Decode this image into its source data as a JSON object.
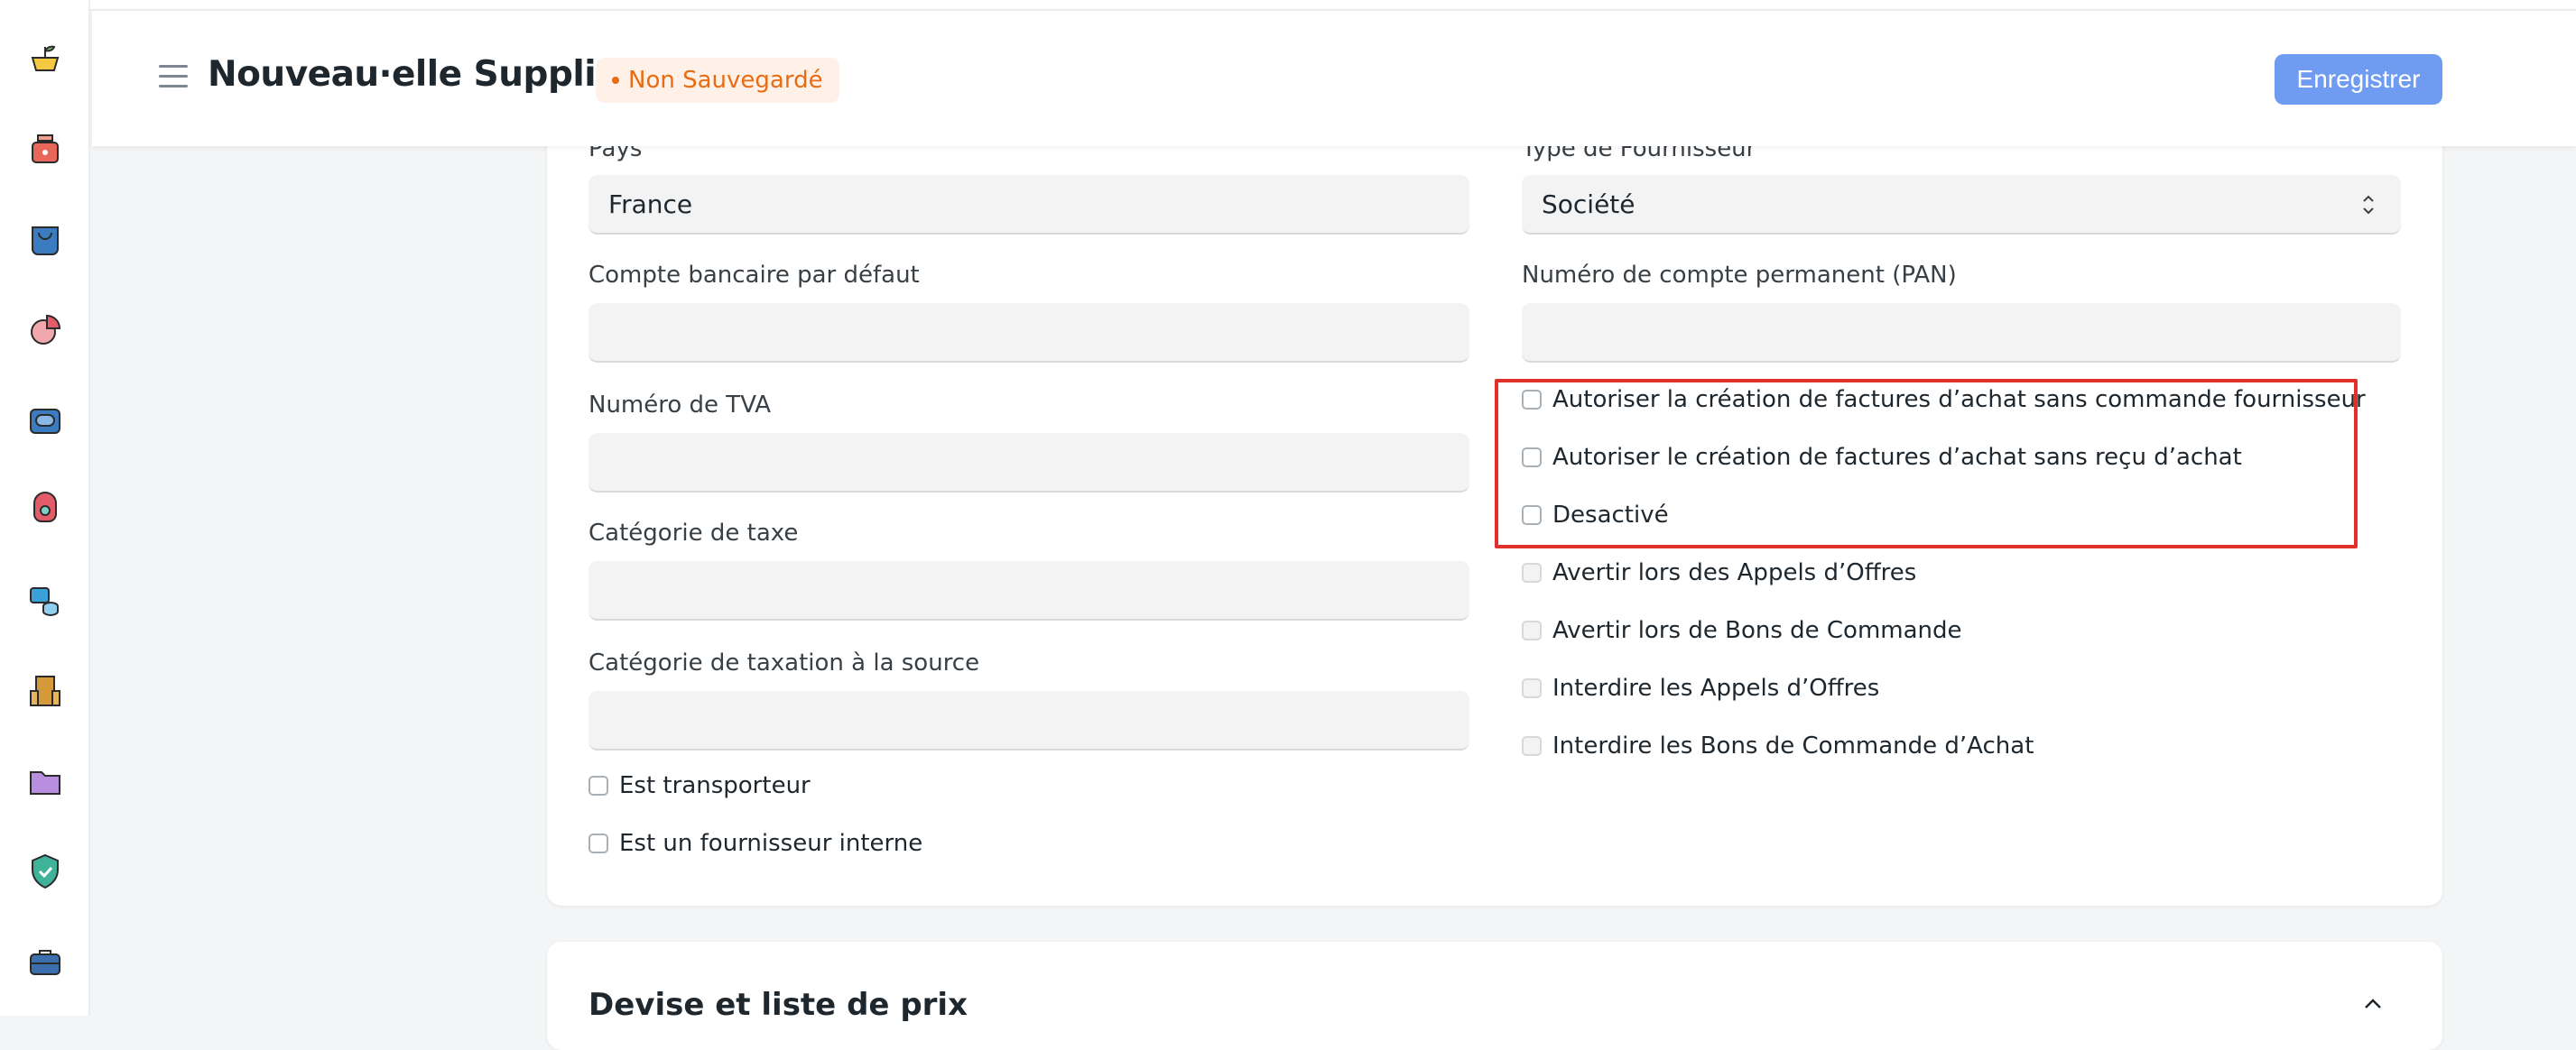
{
  "header": {
    "title": "Nouveau·elle Supplier",
    "status_badge": "Non Sauvegardé",
    "save_label": "Enregistrer"
  },
  "sidebar": {
    "icons": [
      "cart-icon",
      "pos-icon",
      "shopping-bag-icon",
      "pie-chart-icon",
      "stock-icon",
      "support-icon",
      "assets-icon",
      "buildings-icon",
      "folder-icon",
      "shield-check-icon",
      "briefcase-icon"
    ]
  },
  "form": {
    "country": {
      "label": "Pays",
      "value": "France"
    },
    "supplier_type": {
      "label": "Type de Fournisseur",
      "value": "Société"
    },
    "default_bank_account": {
      "label": "Compte bancaire par défaut",
      "value": ""
    },
    "pan": {
      "label": "Numéro de compte permanent (PAN)",
      "value": ""
    },
    "vat_number": {
      "label": "Numéro de TVA",
      "value": ""
    },
    "tax_category": {
      "label": "Catégorie de taxe",
      "value": ""
    },
    "withholding_tax_category": {
      "label": "Catégorie de taxation à la source",
      "value": ""
    },
    "left_checks": [
      {
        "label": "Est transporteur",
        "checked": false
      },
      {
        "label": "Est un fournisseur interne",
        "checked": false
      }
    ],
    "right_checks": [
      {
        "label": "Autoriser la création de factures d’achat sans commande fournisseur",
        "checked": false,
        "disabled": false
      },
      {
        "label": "Autoriser le création de factures d’achat sans reçu d’achat",
        "checked": false,
        "disabled": false
      },
      {
        "label": "Desactivé",
        "checked": false,
        "disabled": false
      },
      {
        "label": "Avertir lors des Appels d’Offres",
        "checked": false,
        "disabled": true
      },
      {
        "label": "Avertir lors de Bons de Commande",
        "checked": false,
        "disabled": true
      },
      {
        "label": "Interdire les Appels d’Offres",
        "checked": false,
        "disabled": true
      },
      {
        "label": "Interdire les Bons de Commande d’Achat",
        "checked": false,
        "disabled": true
      }
    ]
  },
  "next_section": {
    "title": "Devise et liste de prix"
  },
  "colors": {
    "accent": "#6f9bf0",
    "badge_text": "#e86c13",
    "badge_bg": "#fff1e7",
    "highlight": "#e0312a"
  }
}
